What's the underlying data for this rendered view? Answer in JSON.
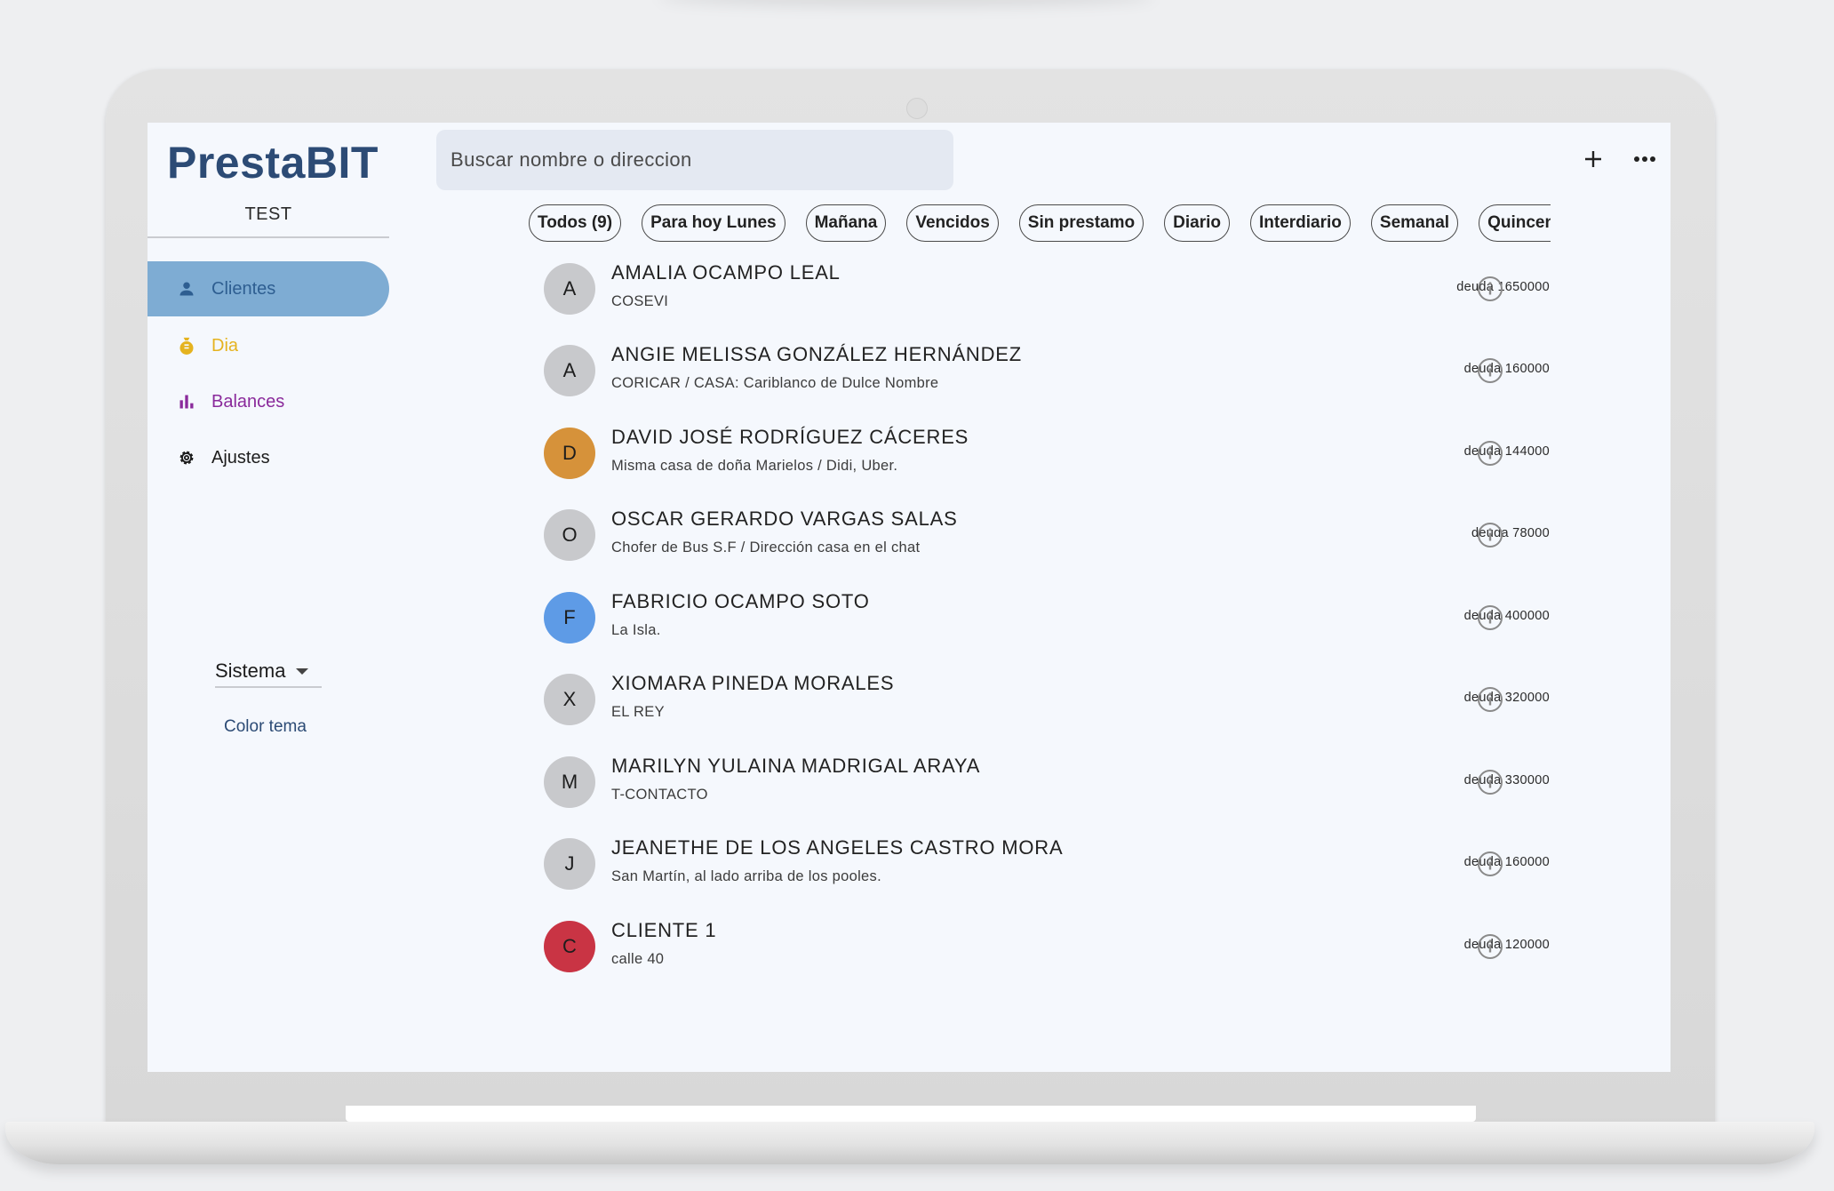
{
  "app": {
    "title": "PrestaBIT",
    "account": "TEST"
  },
  "sidebar": {
    "items": [
      {
        "label": "Clientes",
        "icon": "person-icon",
        "color": "#2e5e91",
        "active": true
      },
      {
        "label": "Dia",
        "icon": "coin-bag-icon",
        "color": "#e5b31f"
      },
      {
        "label": "Balances",
        "icon": "bar-chart-icon",
        "color": "#8a2a9b"
      },
      {
        "label": "Ajustes",
        "icon": "gear-icon",
        "color": "#1c1c1c"
      }
    ],
    "theme_select": {
      "value": "Sistema"
    },
    "color_tema": "Color tema"
  },
  "search": {
    "placeholder": "Buscar nombre o direccion"
  },
  "toolbar": {
    "add_icon": "plus-icon",
    "more_icon": "more-horizontal-icon"
  },
  "filters": [
    "Todos (9)",
    "Para hoy Lunes",
    "Mañana",
    "Vencidos",
    "Sin prestamo",
    "Diario",
    "Interdiario",
    "Semanal",
    "Quincenal"
  ],
  "clients": [
    {
      "initial": "A",
      "name": "AMALIA OCAMPO LEAL",
      "address": "COSEVI",
      "debt": "deuda 1650000",
      "avatar_color": "#c8c9cc"
    },
    {
      "initial": "A",
      "name": "ANGIE MELISSA GONZÁLEZ HERNÁNDEZ",
      "address": "CORICAR / CASA: Cariblanco de Dulce Nombre",
      "debt": "deuda 160000",
      "avatar_color": "#c8c9cc"
    },
    {
      "initial": "D",
      "name": "DAVID JOSÉ RODRÍGUEZ CÁCERES",
      "address": "Misma casa de doña Marielos / Didi, Uber.",
      "debt": "deuda 144000",
      "avatar_color": "#d6923a"
    },
    {
      "initial": "O",
      "name": "OSCAR GERARDO VARGAS SALAS",
      "address": "Chofer de Bus S.F / Dirección casa en el chat",
      "debt": "deuda 78000",
      "avatar_color": "#c8c9cc"
    },
    {
      "initial": "F",
      "name": "FABRICIO OCAMPO SOTO",
      "address": "La Isla.",
      "debt": "deuda 400000",
      "avatar_color": "#5e9be6"
    },
    {
      "initial": "X",
      "name": "XIOMARA PINEDA MORALES",
      "address": "EL REY",
      "debt": "deuda 320000",
      "avatar_color": "#c8c9cc"
    },
    {
      "initial": "M",
      "name": "MARILYN YULAINA MADRIGAL ARAYA",
      "address": "T-CONTACTO",
      "debt": "deuda 330000",
      "avatar_color": "#c8c9cc"
    },
    {
      "initial": "J",
      "name": "JEANETHE DE LOS ANGELES CASTRO MORA",
      "address": "San Martín, al lado arriba de los pooles.",
      "debt": "deuda 160000",
      "avatar_color": "#c8c9cc"
    },
    {
      "initial": "C",
      "name": "CLIENTE 1",
      "address": "calle 40",
      "debt": "deuda 120000",
      "avatar_color": "#c93444"
    }
  ]
}
